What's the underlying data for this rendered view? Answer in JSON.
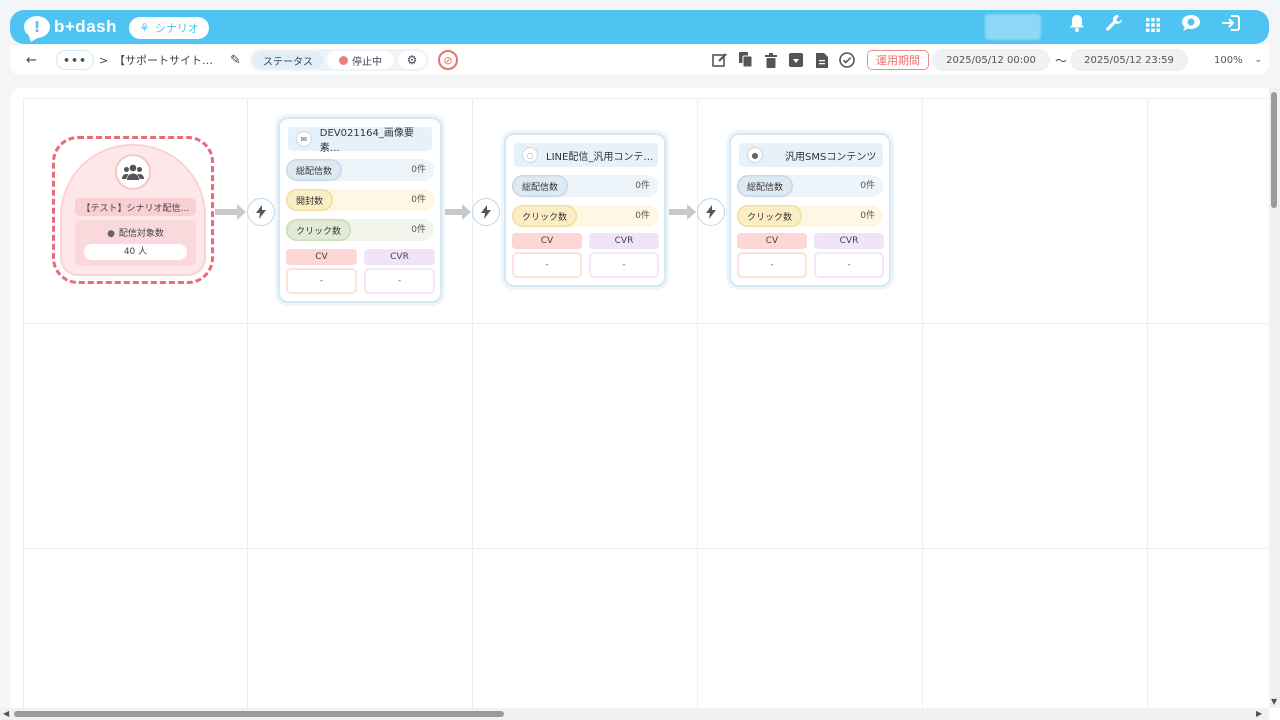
{
  "header": {
    "logo_text": "b+dash",
    "logo_mark": "!",
    "scenario_label": "シナリオ",
    "icons": [
      "bell-icon",
      "wrench-icon",
      "grid-icon",
      "chat-badge-icon",
      "logout-icon"
    ]
  },
  "toolbar": {
    "back": "←",
    "more": "•••",
    "sep": ">",
    "breadcrumb": "【サポートサイト…",
    "status_label": "ステータス",
    "status_value": "停止中",
    "period_label": "運用期間",
    "date_start": "2025/05/12 00:00",
    "date_sep": "〜",
    "date_end": "2025/05/12 23:59",
    "zoom": "100%"
  },
  "start_node": {
    "title": "【テスト】シナリオ配信…",
    "target_label": "配信対象数",
    "target_count": "40 人"
  },
  "nodes": [
    {
      "title": "DEV021164_画像要素…",
      "icon": "mail-icon",
      "metrics": [
        {
          "label": "総配信数",
          "value": "0件"
        },
        {
          "label": "開封数",
          "value": "0件"
        },
        {
          "label": "クリック数",
          "value": "0件"
        }
      ],
      "cv_label": "CV",
      "cv_value": "-",
      "cvr_label": "CVR",
      "cvr_value": "-"
    },
    {
      "title": "LINE配信_汎用コンテ…",
      "icon": "line-icon",
      "metrics": [
        {
          "label": "総配信数",
          "value": "0件"
        },
        {
          "label": "クリック数",
          "value": "0件"
        }
      ],
      "cv_label": "CV",
      "cv_value": "-",
      "cvr_label": "CVR",
      "cvr_value": "-"
    },
    {
      "title": "汎用SMSコンテンツ",
      "icon": "sms-icon",
      "metrics": [
        {
          "label": "総配信数",
          "value": "0件"
        },
        {
          "label": "クリック数",
          "value": "0件"
        }
      ],
      "cv_label": "CV",
      "cv_value": "-",
      "cvr_label": "CVR",
      "cvr_value": "-"
    }
  ],
  "colors": {
    "brand": "#4fc3f2",
    "danger": "#ea6b78",
    "node_border": "#d6e8f5"
  }
}
